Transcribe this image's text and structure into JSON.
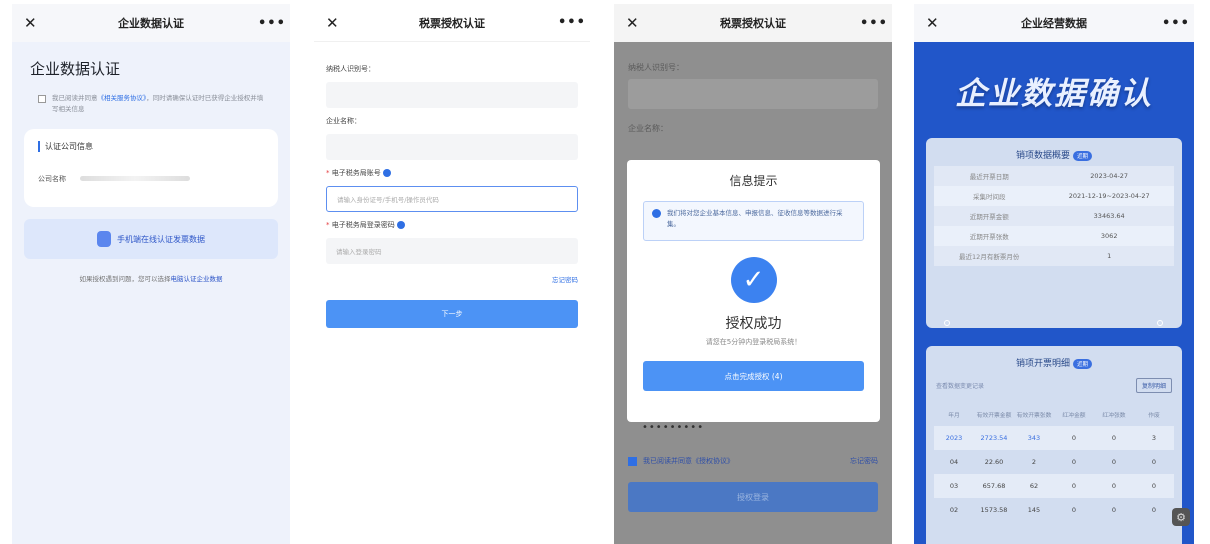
{
  "screens": {
    "s1": {
      "header_title": "企业数据认证",
      "page_title": "企业数据认证",
      "agreement_prefix": "我已阅读并同意",
      "agreement_link": "《相关服务协议》",
      "agreement_suffix": "，同时请确保认证时已获得企业授权并填写相关信息",
      "card_section": "认证公司信息",
      "company_label": "公司名称",
      "primary_button": "手机端在线认证发票数据",
      "footer_text": "如果授权遇到问题，您可以选择",
      "footer_link": "电脑认证企业数据"
    },
    "s2": {
      "header_title": "税票授权认证",
      "taxpayer_id_label": "纳税人识别号：",
      "company_name_label": "企业名称：",
      "etax_account_label": "电子税务局账号",
      "etax_account_placeholder": "请输入身份证号/手机号/操作员代码",
      "etax_password_label": "电子税务局登录密码",
      "etax_password_placeholder": "请输入登录密码",
      "forgot_password": "忘记密码",
      "next_button": "下一步"
    },
    "s3": {
      "header_title": "税票授权认证",
      "bg_label_1": "纳税人识别号：",
      "bg_label_2": "企业名称：",
      "modal_title": "信息提示",
      "info_text": "我们将对您企业基本信息、申报信息、征收信息等数据进行采集。",
      "success_title": "授权成功",
      "success_sub": "请您在5分钟内登录税局系统！",
      "confirm_button": "点击完成授权 (4)",
      "password_mask": "•••••••••",
      "agree_text": "我已阅读并同意《授权协议》",
      "forgot_password": "忘记密码",
      "login_button": "授权登录"
    },
    "s4": {
      "header_title": "企业经营数据",
      "banner": "企业数据确认",
      "overview_title": "销项数据概要",
      "overview_tag": "近期",
      "overview_rows": [
        {
          "k": "最近开票日期",
          "v": "2023-04-27"
        },
        {
          "k": "采集时间段",
          "v": "2021-12-19~2023-04-27"
        },
        {
          "k": "近期开票金额",
          "v": "33463.64"
        },
        {
          "k": "近期开票张数",
          "v": "3062"
        },
        {
          "k": "最近12月有断票月份",
          "v": "1"
        }
      ],
      "detail_title": "销项开票明细",
      "detail_tag": "近期",
      "search_hint": "查看数据变更记录",
      "copy_button": "复制明细",
      "table_headers": [
        "年月",
        "有效开票金额",
        "有效开票张数",
        "红冲金额",
        "红冲张数",
        "作废"
      ],
      "table_rows": [
        [
          "2023",
          "2723.54",
          "343",
          "0",
          "0",
          "3"
        ],
        [
          "04",
          "22.60",
          "2",
          "0",
          "0",
          "0"
        ],
        [
          "03",
          "657.68",
          "62",
          "0",
          "0",
          "0"
        ],
        [
          "02",
          "1573.58",
          "145",
          "0",
          "0",
          "0"
        ]
      ]
    }
  },
  "icons": [
    "close-icon",
    "more-icon",
    "check-icon",
    "info-icon",
    "settings-icon"
  ],
  "colors": {
    "primary": "#4c93f5",
    "brand_blue": "#2156c9",
    "link": "#2f6fe4"
  }
}
